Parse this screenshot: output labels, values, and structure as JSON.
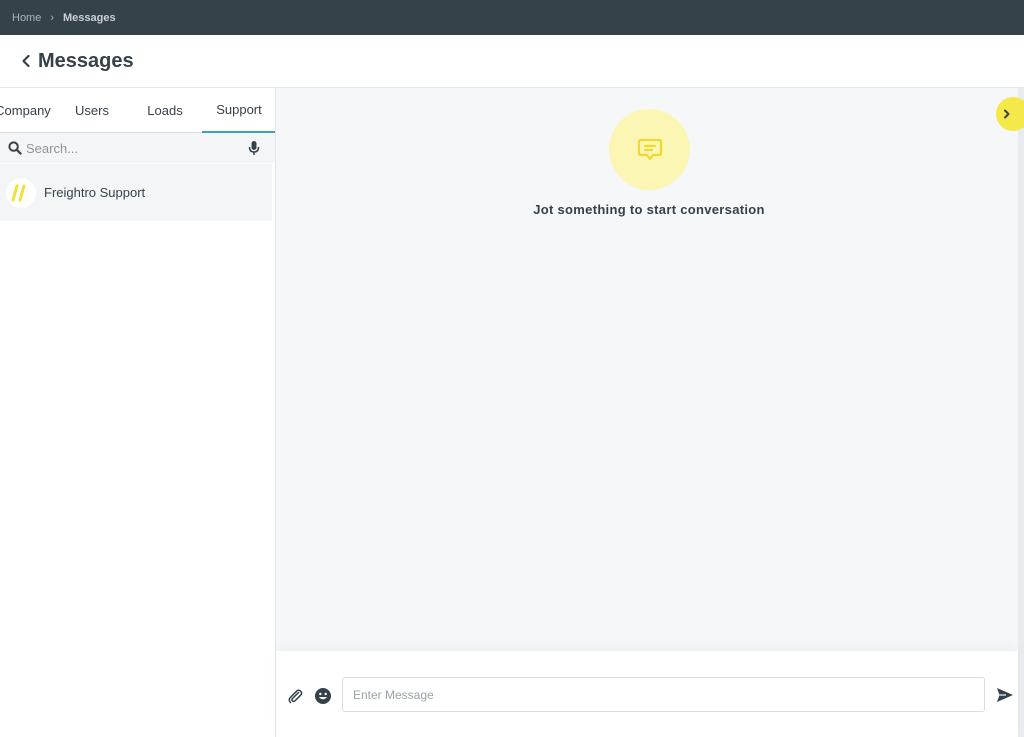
{
  "breadcrumb": {
    "home": "Home",
    "separator": "›",
    "current": "Messages"
  },
  "header": {
    "back_icon": "chevron-left-icon",
    "title": "Messages"
  },
  "tabs": [
    {
      "label": "Company",
      "active": false
    },
    {
      "label": "Users",
      "active": false
    },
    {
      "label": "Loads",
      "active": false
    },
    {
      "label": "Support",
      "active": true
    }
  ],
  "search": {
    "placeholder": "Search...",
    "value": "",
    "icon": "search-icon",
    "mic_icon": "microphone-icon"
  },
  "conversations": [
    {
      "name": "Freightro Support",
      "avatar_icon": "freightro-logo-icon"
    }
  ],
  "empty_state": {
    "icon": "chat-bubble-icon",
    "text": "Jot something to start conversation"
  },
  "composer": {
    "placeholder": "Enter Message",
    "value": "",
    "attach_icon": "paperclip-icon",
    "emoji_icon": "emoji-icon",
    "send_icon": "send-icon"
  },
  "panel_toggle": {
    "icon": "chevron-right-icon"
  },
  "colors": {
    "topbar": "#36424a",
    "accent": "#3fa3b6",
    "highlight": "#f5e84a",
    "empty_circle": "#fbf6b4",
    "text": "#36424a"
  }
}
